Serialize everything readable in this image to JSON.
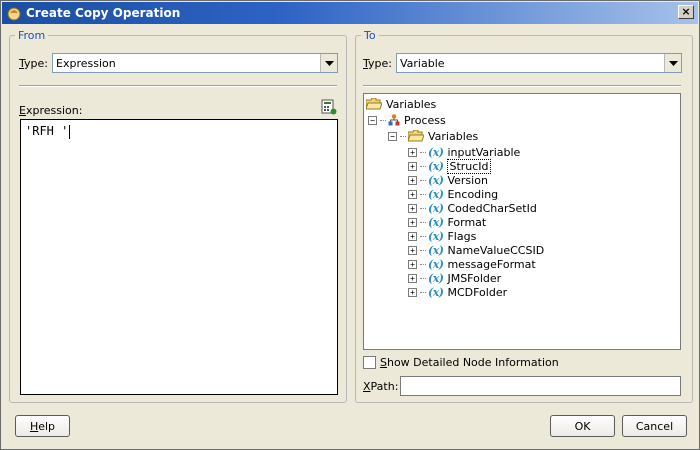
{
  "window": {
    "title": "Create Copy Operation",
    "close_glyph": "×"
  },
  "from": {
    "legend": "From",
    "type_label_prefix": "",
    "type_label_u": "T",
    "type_label_rest": "ype:",
    "type_value": "Expression",
    "expression_label_u": "E",
    "expression_label_rest": "xpression:",
    "expression_text": "'RFH '"
  },
  "to": {
    "legend": "To",
    "type_label_u": "T",
    "type_label_rest": "ype:",
    "type_value": "Variable",
    "tree": {
      "root": "Variables",
      "process": "Process",
      "variables_folder": "Variables",
      "variables": [
        "inputVariable",
        "StrucId",
        "Version",
        "Encoding",
        "CodedCharSetId",
        "Format",
        "Flags",
        "NameValueCCSID",
        "messageFormat",
        "JMSFolder",
        "MCDFolder"
      ],
      "var_icon": "(x)",
      "selected": "StrucId"
    },
    "show_detail_u": "S",
    "show_detail_rest": "how Detailed Node Information",
    "xpath_label_u": "X",
    "xpath_label_rest": "Path:",
    "xpath_value": ""
  },
  "buttons": {
    "help_u": "H",
    "help_rest": "elp",
    "ok": "OK",
    "cancel": "Cancel"
  },
  "colors": {
    "title_bar": "#2d63c4",
    "group_legend": "#1f4fb8",
    "variable_icon": "#2b8fc4"
  }
}
